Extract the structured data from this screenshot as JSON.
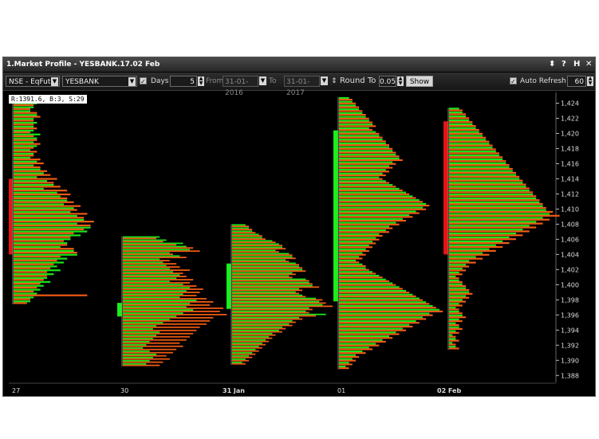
{
  "window": {
    "title": "1.Market Profile - YESBANK.17.02 Feb",
    "controls": {
      "pin": "⬍",
      "help": "?",
      "hide": "H",
      "close": "✕"
    }
  },
  "toolbar": {
    "exchange": "NSE - EqFut",
    "symbol": "YESBANK",
    "days_label": "Days",
    "days_value": "5",
    "from_label": "From",
    "from_date": "31-01-2016",
    "to_label": "To",
    "to_date": "31-01-2017",
    "round_to_label": "Round To",
    "round_to_value": "0.05",
    "show_label": "Show",
    "auto_refresh_label": "Auto Refresh",
    "auto_refresh_checked": true,
    "refresh_value": "60"
  },
  "info_text": "R:1391.6, B:3, S:29",
  "colors": {
    "background": "#000000",
    "buy": "#19e619",
    "sell": "#f05a14",
    "value_area_a": "#e61414",
    "value_area_b": "#19f019",
    "axis_text": "#dddddd"
  },
  "chart_data": {
    "type": "bar",
    "orientation": "horizontal-profile",
    "y_axis": {
      "min": 1387.5,
      "max": 1425,
      "ticks": [
        1388,
        1390,
        1392,
        1394,
        1396,
        1398,
        1400,
        1402,
        1404,
        1406,
        1408,
        1410,
        1412,
        1414,
        1416,
        1418,
        1420,
        1422,
        1424
      ]
    },
    "x_labels": [
      "27",
      "30",
      "31 Jan",
      "01",
      "02 Feb"
    ],
    "sessions": [
      {
        "label": "27",
        "low": 1397.4,
        "high": 1424.6,
        "va_low": 1404.0,
        "va_high": 1414.0,
        "va_color": "red",
        "green": [
          6,
          7,
          6,
          5,
          7,
          6,
          7,
          6,
          6,
          8,
          7,
          6,
          7,
          5,
          6,
          5,
          7,
          6,
          8,
          9,
          7,
          10,
          12,
          9,
          13,
          14,
          16,
          15,
          18,
          17,
          19,
          21,
          19,
          23,
          22,
          20,
          17,
          16,
          14,
          18,
          19,
          16,
          15,
          13,
          14,
          12,
          10,
          11,
          9,
          8,
          7,
          6,
          5
        ],
        "orange": [
          4,
          6,
          5,
          7,
          8,
          6,
          6,
          7,
          5,
          6,
          7,
          8,
          6,
          7,
          6,
          8,
          9,
          8,
          10,
          11,
          13,
          12,
          14,
          16,
          17,
          16,
          18,
          20,
          19,
          22,
          21,
          24,
          23,
          21,
          18,
          17,
          15,
          16,
          18,
          19,
          14,
          13,
          12,
          11,
          10,
          10,
          9,
          8,
          7,
          6,
          22,
          5,
          4
        ]
      },
      {
        "label": "30",
        "low": 1389.2,
        "high": 1406.4,
        "va_low": 1395.8,
        "va_high": 1397.6,
        "va_color": "green",
        "green": [
          11,
          13,
          18,
          19,
          20,
          14,
          17,
          11,
          12,
          13,
          14,
          15,
          17,
          16,
          14,
          18,
          20,
          19,
          18,
          17,
          22,
          20,
          19,
          21,
          18,
          16,
          14,
          12,
          10,
          9,
          11,
          10,
          9,
          8,
          7,
          6,
          8,
          10,
          9,
          8,
          7
        ],
        "orange": [
          10,
          12,
          16,
          21,
          23,
          15,
          19,
          14,
          16,
          17,
          20,
          18,
          19,
          21,
          20,
          22,
          24,
          23,
          22,
          25,
          27,
          26,
          30,
          29,
          31,
          27,
          26,
          25,
          23,
          22,
          21,
          20,
          19,
          17,
          18,
          16,
          15,
          13,
          14,
          12,
          11
        ]
      },
      {
        "label": "31 Jan",
        "low": 1389.4,
        "high": 1408.0,
        "va_low": 1396.8,
        "va_high": 1402.8,
        "va_color": "green",
        "green": [
          4,
          5,
          6,
          8,
          9,
          12,
          14,
          15,
          13,
          17,
          18,
          16,
          19,
          20,
          21,
          18,
          17,
          22,
          23,
          24,
          20,
          19,
          21,
          25,
          26,
          27,
          23,
          22,
          28,
          20,
          18,
          17,
          15,
          14,
          12,
          11,
          10,
          9,
          8,
          7,
          6,
          5,
          4,
          3
        ],
        "orange": [
          5,
          6,
          7,
          9,
          10,
          13,
          15,
          16,
          14,
          18,
          19,
          17,
          20,
          21,
          22,
          19,
          18,
          23,
          24,
          26,
          21,
          20,
          22,
          27,
          28,
          30,
          24,
          23,
          25,
          21,
          19,
          18,
          16,
          15,
          13,
          12,
          11,
          10,
          9,
          8,
          7,
          6,
          5,
          4
        ]
      },
      {
        "label": "01",
        "low": 1388.8,
        "high": 1424.8,
        "va_low": 1397.8,
        "va_high": 1420.4,
        "va_color": "green",
        "green": [
          3,
          4,
          5,
          6,
          7,
          8,
          9,
          10,
          9,
          11,
          12,
          13,
          14,
          15,
          16,
          17,
          18,
          16,
          15,
          14,
          13,
          12,
          14,
          16,
          18,
          20,
          22,
          24,
          26,
          25,
          23,
          21,
          19,
          17,
          15,
          14,
          12,
          11,
          10,
          9,
          8,
          7,
          6,
          5,
          7,
          8,
          10,
          12,
          14,
          16,
          18,
          20,
          22,
          24,
          26,
          28,
          30,
          27,
          25,
          23,
          21,
          19,
          17,
          15,
          13,
          11,
          9,
          7,
          5,
          4,
          3,
          2
        ],
        "orange": [
          4,
          5,
          6,
          7,
          8,
          9,
          10,
          11,
          10,
          12,
          13,
          14,
          15,
          16,
          17,
          18,
          19,
          17,
          16,
          15,
          14,
          13,
          15,
          17,
          19,
          21,
          23,
          25,
          27,
          26,
          24,
          22,
          20,
          18,
          16,
          15,
          13,
          12,
          11,
          10,
          9,
          8,
          7,
          6,
          8,
          9,
          11,
          13,
          15,
          17,
          19,
          21,
          23,
          25,
          27,
          29,
          31,
          28,
          26,
          24,
          22,
          20,
          18,
          16,
          14,
          12,
          10,
          8,
          6,
          5,
          4,
          3
        ]
      },
      {
        "label": "02 Feb",
        "low": 1391.4,
        "high": 1423.4,
        "va_low": 1404.0,
        "va_high": 1421.6,
        "va_color": "red",
        "green": [
          3,
          4,
          5,
          6,
          7,
          8,
          9,
          10,
          11,
          12,
          13,
          14,
          15,
          16,
          17,
          18,
          19,
          20,
          21,
          22,
          23,
          24,
          25,
          26,
          27,
          28,
          29,
          30,
          28,
          26,
          24,
          22,
          20,
          18,
          16,
          14,
          12,
          10,
          8,
          6,
          5,
          4,
          3,
          2,
          3,
          4,
          5,
          6,
          5,
          4,
          3,
          2,
          3,
          4,
          3,
          2,
          3,
          2,
          1,
          2,
          1,
          2
        ],
        "orange": [
          4,
          5,
          6,
          7,
          8,
          9,
          10,
          11,
          12,
          13,
          14,
          15,
          16,
          17,
          18,
          19,
          20,
          21,
          22,
          23,
          24,
          25,
          26,
          27,
          28,
          29,
          31,
          33,
          30,
          28,
          26,
          24,
          22,
          20,
          18,
          16,
          14,
          12,
          10,
          8,
          6,
          5,
          4,
          3,
          4,
          5,
          6,
          7,
          6,
          5,
          4,
          3,
          4,
          5,
          4,
          3,
          4,
          3,
          2,
          3,
          2,
          3
        ]
      }
    ]
  }
}
